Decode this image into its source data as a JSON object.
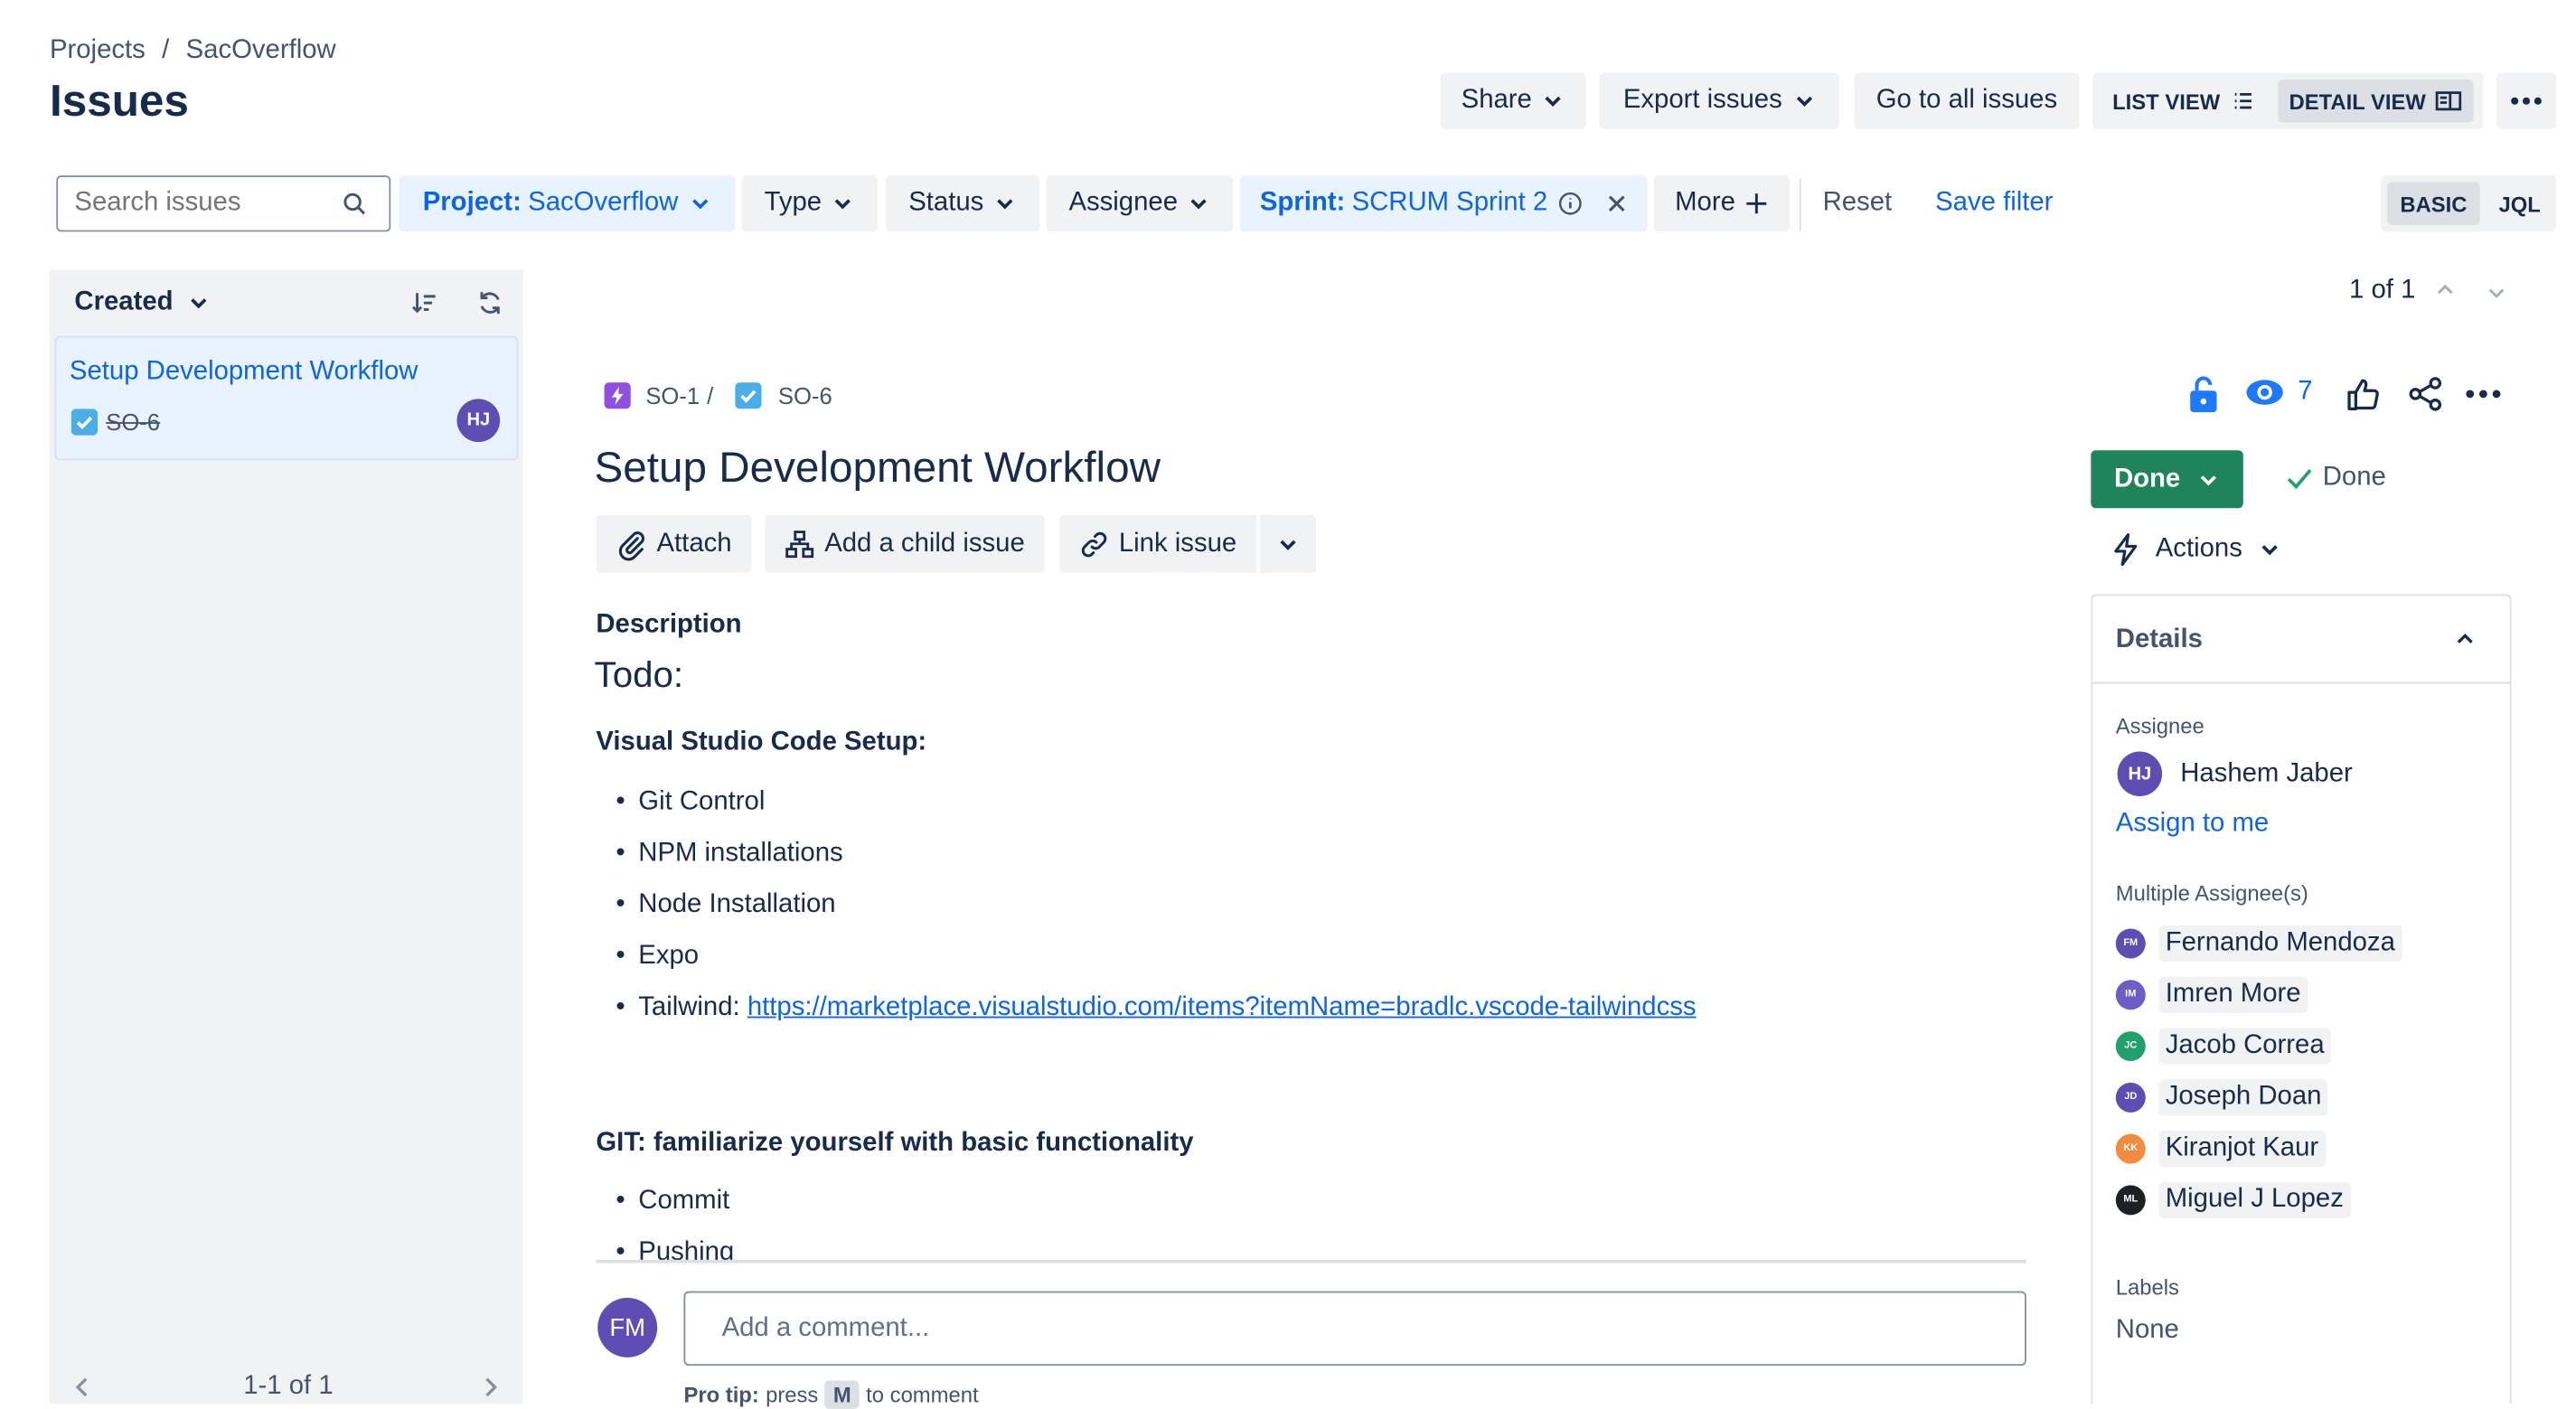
{
  "breadcrumb": {
    "projects": "Projects",
    "separator": "/",
    "project": "SacOverflow"
  },
  "page_title": "Issues",
  "header_actions": {
    "share": "Share",
    "export": "Export issues",
    "all_issues": "Go to all issues",
    "list_view": "LIST VIEW",
    "detail_view": "DETAIL VIEW"
  },
  "filters": {
    "search_placeholder": "Search issues",
    "project_label": "Project:",
    "project_value": "SacOverflow",
    "type": "Type",
    "status": "Status",
    "assignee": "Assignee",
    "sprint_label": "Sprint:",
    "sprint_value": "SCRUM Sprint 2",
    "more": "More",
    "reset": "Reset",
    "save_filter": "Save filter",
    "basic": "BASIC",
    "jql": "JQL"
  },
  "list_panel": {
    "sort_label": "Created",
    "items": [
      {
        "title": "Setup Development Workflow",
        "key": "SO-6",
        "avatar": "HJ"
      }
    ],
    "pagination": "1-1 of 1"
  },
  "pager": "1 of 1",
  "issue": {
    "parent_key": "SO-1",
    "sep": "/",
    "key": "SO-6",
    "watchers": "7",
    "title": "Setup Development Workflow",
    "actions": {
      "attach": "Attach",
      "child": "Add a child issue",
      "link": "Link issue"
    },
    "description_label": "Description",
    "todo_heading": "Todo:",
    "vscode_heading": "Visual Studio Code Setup:",
    "vscode_items": [
      "Git Control",
      "NPM installations",
      "Node Installation",
      "Expo"
    ],
    "tailwind_label": "Tailwind:",
    "tailwind_url": "https://marketplace.visualstudio.com/items?itemName=bradlc.vscode-tailwindcss",
    "git_heading": "GIT: familiarize yourself with basic functionality",
    "git_items": [
      "Commit",
      "Pushing"
    ],
    "comment_avatar": "FM",
    "comment_placeholder": "Add a comment...",
    "pro_tip_label": "Pro tip:",
    "pro_tip_press": "press",
    "pro_tip_key": "M",
    "pro_tip_rest": "to comment"
  },
  "status": {
    "button": "Done",
    "resolution": "Done",
    "actions": "Actions"
  },
  "details": {
    "title": "Details",
    "assignee_label": "Assignee",
    "assignee": {
      "initials": "HJ",
      "name": "Hashem Jaber"
    },
    "assign_to_me": "Assign to me",
    "multi_label": "Multiple Assignee(s)",
    "multi": [
      {
        "initials": "FM",
        "name": "Fernando Mendoza",
        "color": "#5e4db2"
      },
      {
        "initials": "IM",
        "name": "Imren More",
        "color": "#6e5dc6"
      },
      {
        "initials": "JC",
        "name": "Jacob Correa",
        "color": "#22a06b"
      },
      {
        "initials": "JD",
        "name": "Joseph Doan",
        "color": "#5e4db2"
      },
      {
        "initials": "KK",
        "name": "Kiranjot Kaur",
        "color": "#f38a3f"
      },
      {
        "initials": "ML",
        "name": "Miguel J Lopez",
        "color": "#1d2125"
      }
    ],
    "labels_label": "Labels",
    "labels_value": "None"
  },
  "colors": {
    "accent": "#0c66e4",
    "done_green": "#1f845a",
    "avatar_purple": "#5e4db2"
  }
}
